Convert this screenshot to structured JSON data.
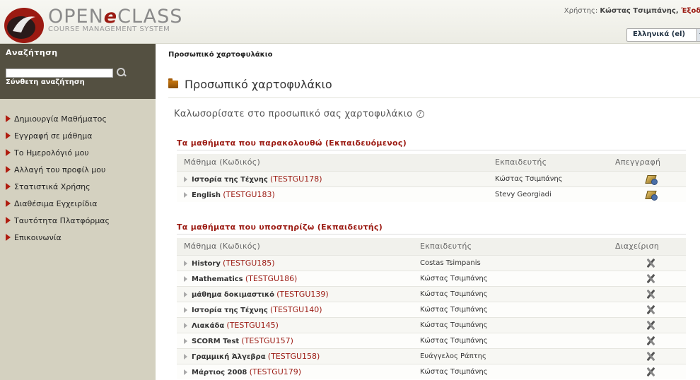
{
  "app": {
    "logo_main_left": "OPEN",
    "logo_e": "e",
    "logo_main_right": "CLASS",
    "logo_sub": "COURSE MANAGEMENT SYSTEM"
  },
  "user": {
    "prefix": "Χρήστης: ",
    "name": "Κώστας Τσιμπάνης",
    "sep": ", ",
    "logout": "Έξοδος"
  },
  "language": {
    "selected": "Ελληνικά (el)"
  },
  "sidebar": {
    "search_title": "Αναζήτηση",
    "search_placeholder": "",
    "advanced_search": "Σύνθετη αναζήτηση",
    "items": [
      {
        "label": "Δημιουργία Μαθήματος"
      },
      {
        "label": "Εγγραφή σε μάθημα"
      },
      {
        "label": "Το Ημερολόγιό μου"
      },
      {
        "label": "Αλλαγή του προφίλ μου"
      },
      {
        "label": "Στατιστικά Χρήσης"
      },
      {
        "label": "Διαθέσιμα Εγχειρίδια"
      },
      {
        "label": "Ταυτότητα Πλατφόρμας"
      },
      {
        "label": "Επικοινωνία"
      }
    ]
  },
  "main": {
    "breadcrumb": "Προσωπικό χαρτοφυλάκιο",
    "title": "Προσωπικό χαρτοφυλάκιο",
    "welcome": "Καλωσορίσατε στο προσωπικό σας χαρτοφυλάκιο",
    "help_glyph": "?",
    "student_section": {
      "title": "Τα μαθήματα που παρακολουθώ (Εκπαιδευόμενος)",
      "headers": [
        "Μάθημα (Κωδικός)",
        "Εκπαιδευτής",
        "Απεγγραφή"
      ],
      "rows": [
        {
          "title": "Ιστορία της Τέχνης",
          "code": "(TESTGU178)",
          "instructor": "Κώστας Τσιμπάνης"
        },
        {
          "title": "English",
          "code": "(TESTGU183)",
          "instructor": "Stevy Georgiadi"
        }
      ]
    },
    "teacher_section": {
      "title": "Τα μαθήματα που υποστηρίζω (Εκπαιδευτής)",
      "headers": [
        "Μάθημα (Κωδικός)",
        "Εκπαιδευτής",
        "Διαχείριση"
      ],
      "rows": [
        {
          "title": "History",
          "code": "(TESTGU185)",
          "instructor": "Costas Tsimpanis"
        },
        {
          "title": "Mathematics",
          "code": "(TESTGU186)",
          "instructor": "Κώστας Τσιμπάνης"
        },
        {
          "title": "μάθημα δοκιμαστικό",
          "code": "(TESTGU139)",
          "instructor": "Κώστας Τσιμπάνης"
        },
        {
          "title": "Ιστορία της Τέχνης",
          "code": "(TESTGU140)",
          "instructor": "Κώστας Τσιμπάνης"
        },
        {
          "title": "Λιακάδα",
          "code": "(TESTGU145)",
          "instructor": "Κώστας Τσιμπάνης"
        },
        {
          "title": "SCORM Test",
          "code": "(TESTGU157)",
          "instructor": "Κώστας Τσιμπάνης"
        },
        {
          "title": "Γραμμική Άλγεβρα",
          "code": "(TESTGU158)",
          "instructor": "Ευάγγελος Ράπτης"
        },
        {
          "title": "Μάρτιος 2008",
          "code": "(TESTGU179)",
          "instructor": "Κώστας Τσιμπάνης"
        }
      ]
    }
  }
}
